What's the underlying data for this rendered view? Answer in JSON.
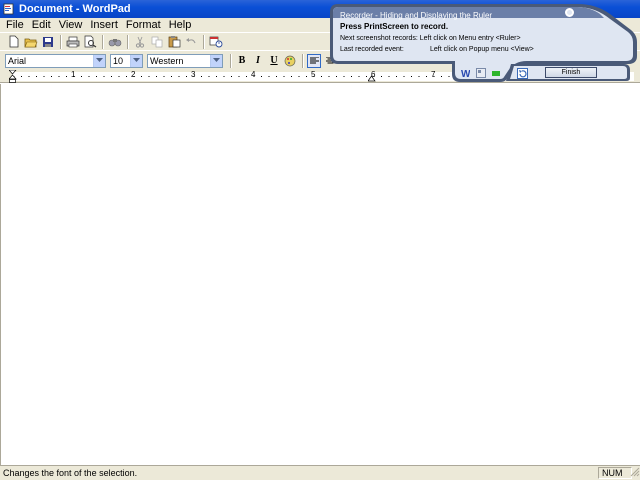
{
  "window": {
    "title": "Document - WordPad"
  },
  "menu": {
    "items": [
      "File",
      "Edit",
      "View",
      "Insert",
      "Format",
      "Help"
    ]
  },
  "toolbar": {
    "buttons": [
      "new-icon",
      "open-icon",
      "save-icon",
      "print-icon",
      "print-preview-icon",
      "find-icon",
      "cut-icon",
      "copy-icon",
      "paste-icon",
      "undo-icon",
      "date-time-icon"
    ]
  },
  "format": {
    "font": "Arial",
    "size": "10",
    "script": "Western",
    "bold_label": "B",
    "italic_label": "I",
    "underline_label": "U"
  },
  "ruler": {
    "numbers": [
      "1",
      "2",
      "3",
      "4",
      "5",
      "6",
      "7"
    ]
  },
  "status": {
    "text": "Changes the font of the selection.",
    "num": "NUM"
  },
  "recorder": {
    "title": "Recorder - Hiding and Displaying the Ruler",
    "instruction": "Press PrintScreen to record.",
    "next_label": "Next screenshot records:",
    "next_value": "Left click on Menu entry <Ruler>",
    "last_label": "Last recorded event:",
    "last_value": "Left click on Popup menu <View>",
    "finish_label": "Finish"
  },
  "colors": {
    "titlebar": "#0a4fd6",
    "chrome": "#ece9d8",
    "recorder_body": "#dfe6f2",
    "recorder_border": "#4a5a78"
  }
}
